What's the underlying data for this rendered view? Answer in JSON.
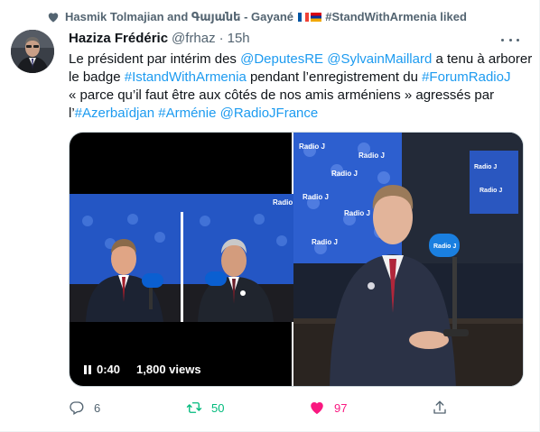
{
  "social_context": {
    "prefix": "Hasmik Tolmajian and Գայանե - Gayané",
    "suffix": "#StandWithArmenia liked"
  },
  "author": {
    "name": "Haziza Frédéric",
    "handle": "@frhaz",
    "separator": "·",
    "time": "15h"
  },
  "tweet_text": {
    "l1_a": "Le président par intérim des ",
    "l1_link1": "@DeputesRE",
    "l1_space": " ",
    "l1_link2": "@SylvainMaillard",
    "l1_b": " a tenu à arborer",
    "l2_a": "le badge ",
    "l2_link1": "#IstandWithArmenia",
    "l2_b": " pendant l’enregistrement du ",
    "l2_link2": "#ForumRadioJ",
    "l3": " « parce qu’il faut être aux côtés de nos amis arméniens » agressés par",
    "l4_a": "l’",
    "l4_link1": "#Azerbaïdjan",
    "l4_s1": " ",
    "l4_link2": "#Arménie",
    "l4_s2": " ",
    "l4_link3": "@RadioJFrance"
  },
  "video": {
    "time": "0:40",
    "views": "1,800 views"
  },
  "actions": {
    "reply_count": "6",
    "retweet_count": "50",
    "like_count": "97"
  },
  "colors": {
    "link": "#1d9bf0",
    "secondary_text": "#536471",
    "retweet_green": "#00ba7c",
    "like_pink": "#f91880"
  },
  "icons": [
    "heart-icon",
    "more-icon",
    "pause-icon",
    "reply-icon",
    "retweet-icon",
    "like-icon",
    "share-icon"
  ]
}
